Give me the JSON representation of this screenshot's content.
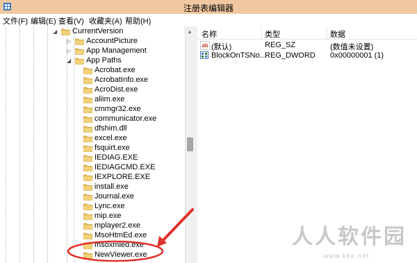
{
  "window": {
    "title": "注册表编辑器"
  },
  "menu": [
    "文件(F)",
    "编辑(E)",
    "查看(V)",
    "收藏夹(A)",
    "帮助(H)"
  ],
  "tree": {
    "items": [
      {
        "label": "CurrentVersion",
        "expanded": true
      },
      {
        "label": "AccountPicture",
        "expanded": false
      },
      {
        "label": "App Management",
        "expanded": false
      },
      {
        "label": "App Paths",
        "expanded": true
      },
      {
        "label": "Acrobat.exe"
      },
      {
        "label": "AcrobatInfo.exe"
      },
      {
        "label": "AcroDist.exe"
      },
      {
        "label": "aliim.exe"
      },
      {
        "label": "cmmgr32.exe"
      },
      {
        "label": "communicator.exe"
      },
      {
        "label": "dfshim.dll"
      },
      {
        "label": "excel.exe"
      },
      {
        "label": "fsquirt.exe"
      },
      {
        "label": "IEDIAG.EXE"
      },
      {
        "label": "IEDIAGCMD.EXE"
      },
      {
        "label": "IEXPLORE.EXE"
      },
      {
        "label": "install.exe"
      },
      {
        "label": "Journal.exe"
      },
      {
        "label": "Lync.exe"
      },
      {
        "label": "mip.exe"
      },
      {
        "label": "mplayer2.exe"
      },
      {
        "label": "MsoHtmEd.exe"
      },
      {
        "label": "msoxmled.exe"
      },
      {
        "label": "NewViewer.exe"
      }
    ]
  },
  "values": {
    "headers": [
      "名称",
      "类型",
      "数据"
    ],
    "rows": [
      {
        "icon": "ab",
        "name": "(默认)",
        "type": "REG_SZ",
        "data": "(数值未设置)"
      },
      {
        "icon": "bin",
        "name": "BlockOnTSNo...",
        "type": "REG_DWORD",
        "data": "0x00000001 (1)"
      }
    ]
  },
  "watermark": {
    "main": "人人软件园",
    "url": "www.kkx.net"
  },
  "colors": {
    "titlebar": "#f0c8a0",
    "folder": "#e8c062",
    "annotation": "#e0302a"
  },
  "icons": {
    "folder": "folder-icon",
    "string_value": "string-value-icon",
    "dword_value": "dword-value-icon"
  }
}
